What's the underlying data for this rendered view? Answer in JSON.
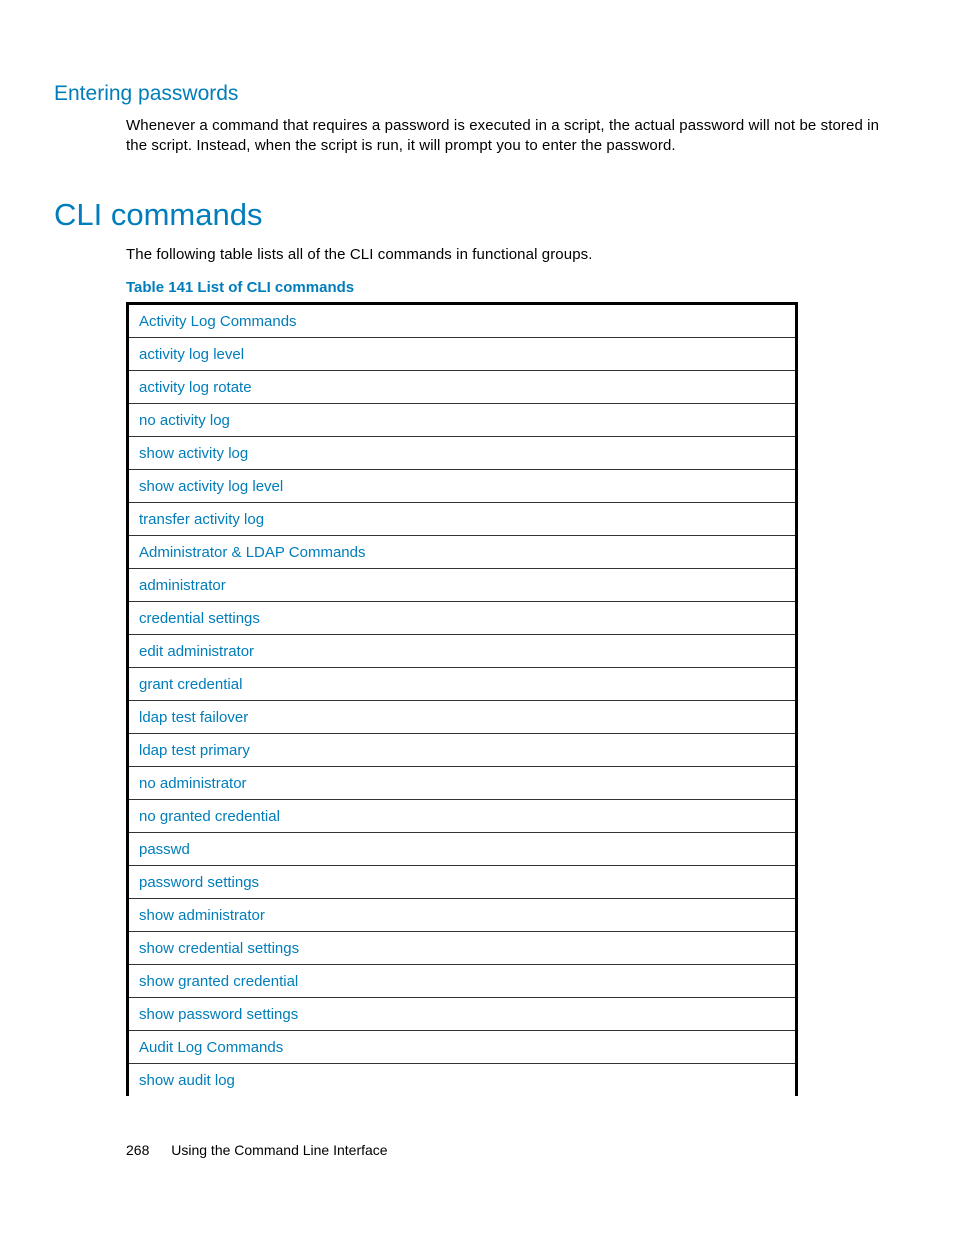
{
  "section": {
    "heading3": "Entering passwords",
    "body": "Whenever a command that requires a password is executed in a script, the actual password will not be stored in the script. Instead, when the script is run, it will prompt you to enter the password."
  },
  "cli": {
    "heading1": "CLI commands",
    "intro": "The following table lists all of the CLI commands in functional groups.",
    "table_caption": "Table 141 List of CLI commands",
    "rows": [
      "Activity Log Commands",
      "activity log level",
      "activity log rotate",
      "no activity log",
      "show activity log",
      "show activity log level",
      "transfer activity log",
      "Administrator & LDAP Commands",
      "administrator",
      "credential settings",
      "edit administrator",
      "grant credential",
      "ldap test failover",
      "ldap test primary",
      "no administrator",
      "no granted credential",
      "passwd",
      "password settings",
      "show administrator",
      "show credential settings",
      "show granted credential",
      "show password settings",
      "Audit Log Commands",
      "show audit log"
    ]
  },
  "footer": {
    "page_number": "268",
    "chapter": "Using the Command Line Interface"
  }
}
